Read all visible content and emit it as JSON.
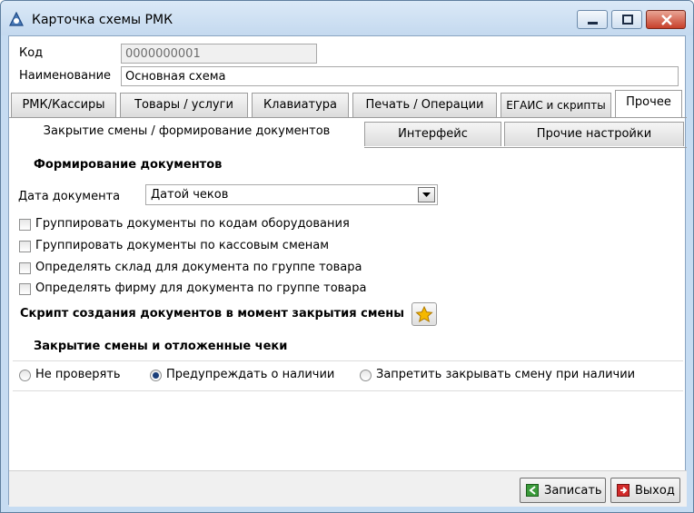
{
  "window": {
    "title": "Карточка схемы РМК",
    "controls": [
      "minimize",
      "maximize",
      "close"
    ]
  },
  "header": {
    "code_label": "Код",
    "code_value": "0000000001",
    "name_label": "Наименование",
    "name_value": "Основная схема"
  },
  "tabs": [
    {
      "label": "РМК/Кассиры"
    },
    {
      "label": "Товары / услуги"
    },
    {
      "label": "Клавиатура"
    },
    {
      "label": "Печать / Операции"
    },
    {
      "label": "ЕГАИС и скрипты"
    },
    {
      "label": "Прочее",
      "active": true
    }
  ],
  "subtabs": [
    {
      "label": "Закрытие смены / формирование документов",
      "active": true
    },
    {
      "label": "Интерфейс"
    },
    {
      "label": "Прочие настройки"
    }
  ],
  "documents": {
    "section_title": "Формирование документов",
    "date_label": "Дата документа",
    "date_value": "Датой чеков",
    "checkboxes": [
      {
        "label": "Группировать документы по кодам оборудования",
        "checked": false
      },
      {
        "label": "Группировать документы по кассовым сменам",
        "checked": false
      },
      {
        "label": "Определять склад для документа по группе товара",
        "checked": false
      },
      {
        "label": "Определять фирму для  документа по группе товара",
        "checked": false
      }
    ],
    "script_label": "Скрипт создания документов в момент закрытия смены",
    "script_icon": "star-icon"
  },
  "shift": {
    "section_title": "Закрытие смены и отложенные чеки",
    "options": [
      {
        "label": "Не проверять",
        "selected": false
      },
      {
        "label": "Предупреждать о наличии",
        "selected": true
      },
      {
        "label": "Запретить закрывать смену при наличии",
        "selected": false
      }
    ]
  },
  "footer": {
    "save_label": "Записать",
    "exit_label": "Выход"
  },
  "colors": {
    "title_bar": "#c4d9ef",
    "close_button": "#c7402a",
    "radio_selected": "#1b3f7a",
    "star": "#f5b800"
  }
}
